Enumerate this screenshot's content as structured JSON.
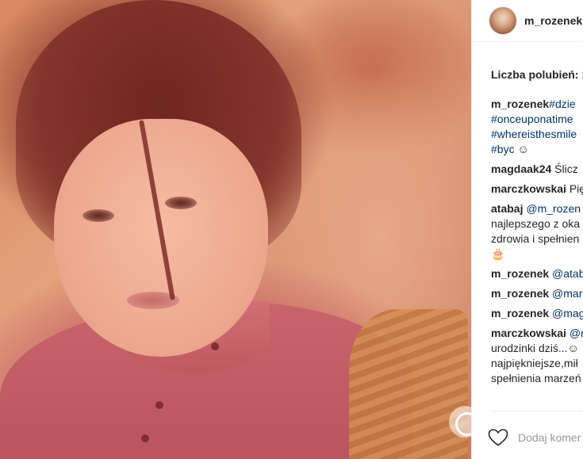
{
  "post": {
    "username": "m_rozenek",
    "likes_label": "Liczba polubień: 1",
    "comments": [
      {
        "user": "m_rozenek",
        "lines": [
          [
            {
              "kind": "tag",
              "text": "#dzie"
            }
          ],
          [
            {
              "kind": "tag",
              "text": "#onceuponatime"
            }
          ],
          [
            {
              "kind": "tag",
              "text": "#whereisthesmile"
            }
          ],
          [
            {
              "kind": "tag",
              "text": "#byc"
            },
            {
              "kind": "text",
              "text": " ☺"
            }
          ]
        ]
      },
      {
        "user": "magdaak24",
        "lines": [
          [
            {
              "kind": "text",
              "text": " Ślicz"
            }
          ]
        ]
      },
      {
        "user": "marczkowskai",
        "lines": [
          [
            {
              "kind": "text",
              "text": " Pię"
            }
          ]
        ]
      },
      {
        "user": "atabaj",
        "lines": [
          [
            {
              "kind": "tag",
              "text": " @m_rozen"
            }
          ],
          [
            {
              "kind": "text",
              "text": "najlepszego z oka"
            }
          ],
          [
            {
              "kind": "text",
              "text": "zdrowia i spełnien"
            }
          ],
          [
            {
              "kind": "text",
              "text": "🎂"
            }
          ]
        ]
      },
      {
        "user": "m_rozenek",
        "lines": [
          [
            {
              "kind": "tag",
              "text": " @atab"
            }
          ]
        ]
      },
      {
        "user": "m_rozenek",
        "lines": [
          [
            {
              "kind": "tag",
              "text": " @mar"
            }
          ]
        ]
      },
      {
        "user": "m_rozenek",
        "lines": [
          [
            {
              "kind": "tag",
              "text": " @mag"
            }
          ]
        ]
      },
      {
        "user": "marczkowskai",
        "lines": [
          [
            {
              "kind": "tag",
              "text": " @m"
            }
          ],
          [
            {
              "kind": "text",
              "text": "urodzinki dziś...☺"
            }
          ],
          [
            {
              "kind": "text",
              "text": "najpiękniejsze,mił"
            }
          ],
          [
            {
              "kind": "text",
              "text": "spełnienia marzeń"
            }
          ]
        ]
      }
    ],
    "add_comment_placeholder": "Dodaj komer",
    "icons": {
      "heart": "heart-outline-icon",
      "watermark": "site-logo-icon"
    },
    "colors": {
      "hashtag": "#003569",
      "text": "#262626",
      "muted": "#999999"
    }
  }
}
